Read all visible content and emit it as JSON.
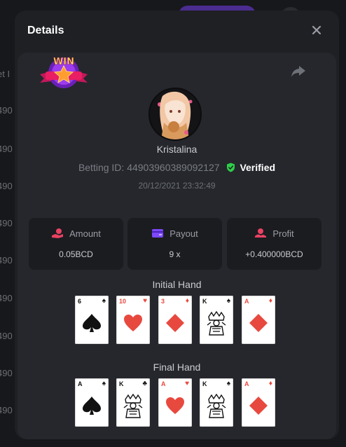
{
  "modal": {
    "title": "Details"
  },
  "player": {
    "name": "Kristalina",
    "betting_id_label": "Betting ID: 44903960389092127",
    "verified_label": "Verified",
    "timestamp": "20/12/2021 23:32:49"
  },
  "badge": {
    "text": "WIN"
  },
  "stats": [
    {
      "label": "Amount",
      "value": "0.05BCD",
      "icon": "coins-hand-icon"
    },
    {
      "label": "Payout",
      "value": "9 x",
      "icon": "wallet-icon"
    },
    {
      "label": "Profit",
      "value": "+0.400000BCD",
      "icon": "profit-hand-icon"
    }
  ],
  "initial_hand": {
    "title": "Initial Hand",
    "cards": [
      {
        "rank": "6",
        "suit": "spade"
      },
      {
        "rank": "10",
        "suit": "heart"
      },
      {
        "rank": "3",
        "suit": "diamond"
      },
      {
        "rank": "K",
        "suit": "spade"
      },
      {
        "rank": "A",
        "suit": "diamond"
      }
    ]
  },
  "final_hand": {
    "title": "Final Hand",
    "cards": [
      {
        "rank": "A",
        "suit": "spade"
      },
      {
        "rank": "K",
        "suit": "club"
      },
      {
        "rank": "A",
        "suit": "heart"
      },
      {
        "rank": "K",
        "suit": "spade"
      },
      {
        "rank": "A",
        "suit": "diamond"
      }
    ]
  },
  "colors": {
    "backdrop": "#17181b",
    "modal_bg": "#1f2024",
    "panel_bg": "#25272c",
    "stat_bg": "#1b1c20",
    "verified_green": "#2fcf4a",
    "amount_icon": "#e94262",
    "payout_icon": "#7d48ff",
    "profit_icon": "#e94262",
    "card_red": "#e8493f"
  }
}
